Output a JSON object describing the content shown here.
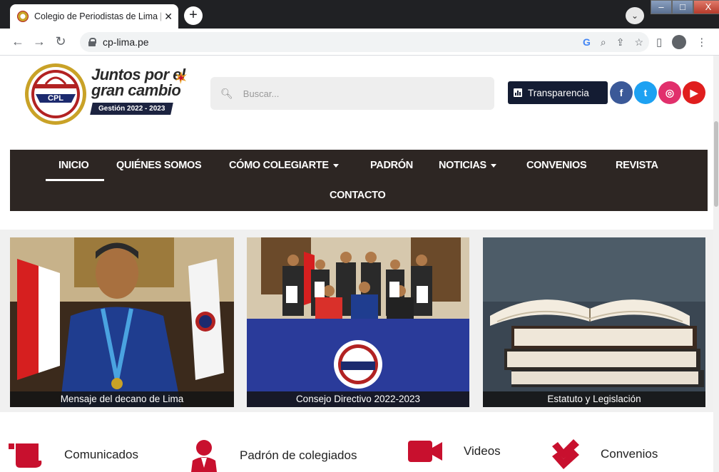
{
  "browser": {
    "tab_title": "Colegio de Periodistas de Lima | Inicio",
    "tab_close": "✕",
    "new_tab": "+",
    "url": "cp-lima.pe",
    "window_controls": {
      "minimize": "–",
      "maximize": "□",
      "close": "X"
    }
  },
  "header": {
    "slogan_line1": "Juntos por el",
    "slogan_line2": "gran cambio",
    "gestion_badge": "Gestión 2022 - 2023",
    "logo_text": "CPL",
    "search_placeholder": "Buscar...",
    "transparencia_label": "Transparencia",
    "social": {
      "facebook_glyph": "f",
      "twitter_glyph": "t",
      "instagram_glyph": "◎",
      "youtube_glyph": "▶"
    }
  },
  "nav": {
    "items": [
      {
        "label": "INICIO"
      },
      {
        "label": "QUIÉNES SOMOS"
      },
      {
        "label": "CÓMO COLEGIARTE"
      },
      {
        "label": "PADRÓN"
      },
      {
        "label": "NOTICIAS"
      },
      {
        "label": "CONVENIOS"
      },
      {
        "label": "REVISTA"
      },
      {
        "label": "CONTACTO"
      }
    ]
  },
  "cards": [
    {
      "caption": "Mensaje del decano de Lima"
    },
    {
      "caption": "Consejo Directivo 2022-2023"
    },
    {
      "caption": "Estatuto y Legislación"
    }
  ],
  "quick_links": [
    {
      "label": "Comunicados",
      "icon": "scroll-icon"
    },
    {
      "label": "Padrón de colegiados",
      "icon": "person-icon"
    },
    {
      "label": "Videos",
      "icon": "video-camera-icon"
    },
    {
      "label": "Convenios",
      "icon": "double-check-icon"
    }
  ],
  "colors": {
    "accent_red": "#c8102e",
    "nav_bg": "#2d2623",
    "transparencia_bg": "#141c33"
  }
}
